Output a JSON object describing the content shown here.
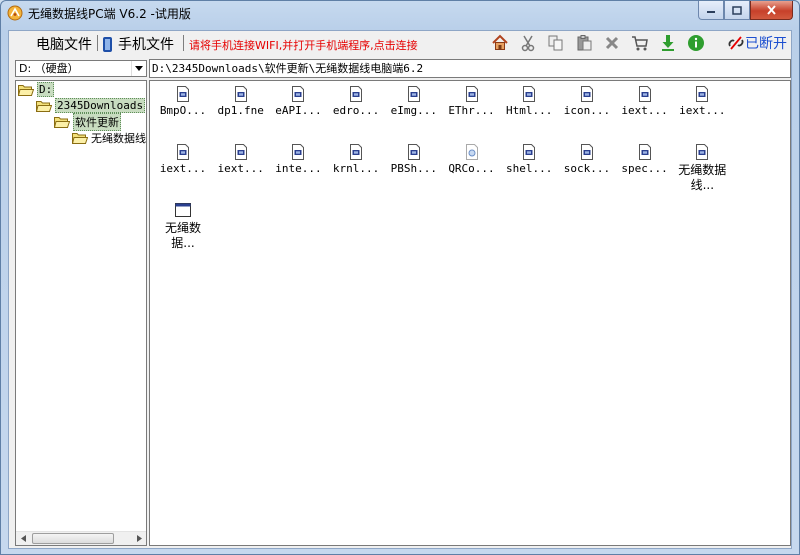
{
  "window": {
    "title": "无绳数据线PC端 V6.2 -试用版"
  },
  "toolbar": {
    "tab_pc": "电脑文件",
    "tab_phone": "手机文件",
    "hint": "请将手机连接WIFI,并打开手机端程序,点击连接",
    "disconnect_label": "已断开",
    "tools": [
      "home-icon",
      "cut-icon",
      "copy-icon",
      "paste-icon",
      "delete-icon",
      "cart-icon",
      "download-icon",
      "info-icon"
    ]
  },
  "drive": {
    "selected": "D: （硬盘）"
  },
  "path": {
    "value": "D:\\2345Downloads\\软件更新\\无绳数据线电脑端6.2"
  },
  "tree": {
    "root": "D:",
    "child": "2345Downloads",
    "grandchild": "软件更新",
    "leaf": "无绳数据线"
  },
  "files": [
    "BmpO...",
    "dp1.fne",
    "eAPI...",
    "edro...",
    "eImg...",
    "EThr...",
    "Html...",
    "icon...",
    "iext...",
    "iext...",
    "iext...",
    "iext...",
    "inte...",
    "krnl...",
    "PBSh...",
    "QRCo...",
    "shel...",
    "sock...",
    "spec...",
    "无绳数据线...",
    "无绳数据..."
  ],
  "colors": {
    "hint": "#e60000",
    "disconnect": "#1c4fd0",
    "tree_selection": "#c8dcc0"
  }
}
